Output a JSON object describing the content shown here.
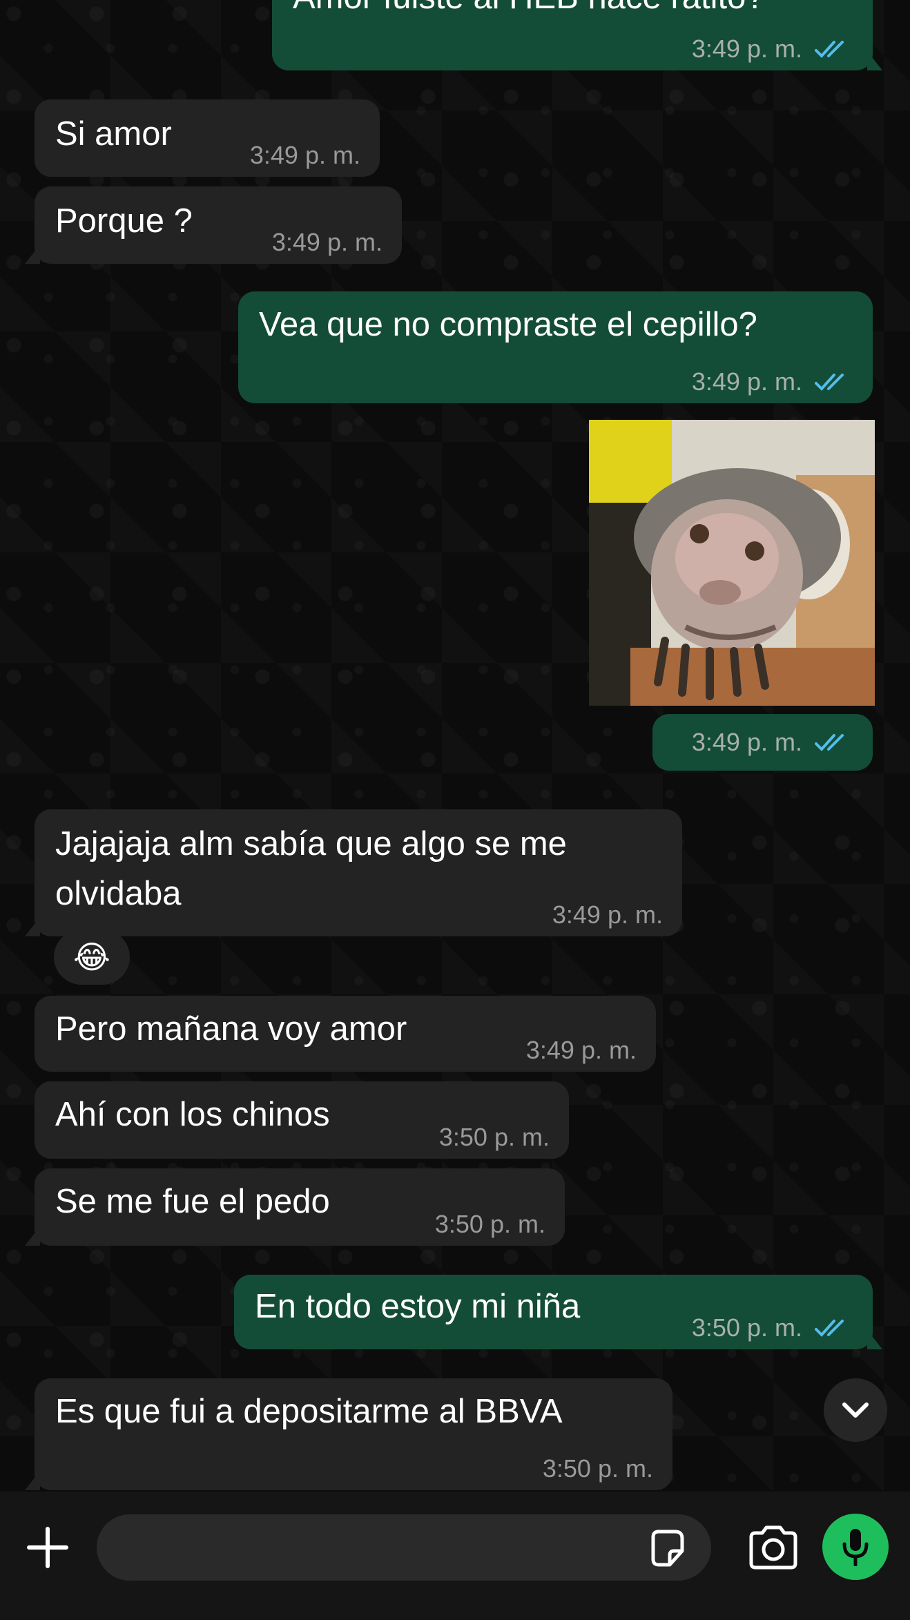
{
  "messages": [
    {
      "dir": "out",
      "text": "Amor fuiste al HEB hace ratito?",
      "time": "3:49",
      "ampm": "p. m."
    },
    {
      "dir": "in",
      "text": "Si amor",
      "time": "3:49",
      "ampm": "p. m."
    },
    {
      "dir": "in",
      "text": "Porque ?",
      "time": "3:49",
      "ampm": "p. m."
    },
    {
      "dir": "out",
      "text": "Vea que no compraste el cepillo?",
      "time": "3:49",
      "ampm": "p. m."
    },
    {
      "dir": "out",
      "type": "image",
      "image_desc": "monkey-photo",
      "time": "3:49",
      "ampm": "p. m."
    },
    {
      "dir": "in",
      "text": "Jajajaja alm sabía que algo se me olvidaba",
      "time": "3:49",
      "ampm": "p. m.",
      "reaction": "😂"
    },
    {
      "dir": "in",
      "text": "Pero mañana voy amor",
      "time": "3:49",
      "ampm": "p. m."
    },
    {
      "dir": "in",
      "text": "Ahí con los chinos",
      "time": "3:50",
      "ampm": "p. m."
    },
    {
      "dir": "in",
      "text": "Se me fue el pedo",
      "time": "3:50",
      "ampm": "p. m."
    },
    {
      "dir": "out",
      "text": "En todo estoy mi niña",
      "time": "3:50",
      "ampm": "p. m."
    },
    {
      "dir": "in",
      "text": "Es que fui a depositarme al BBVA",
      "time": "3:50",
      "ampm": "p. m."
    }
  ],
  "composer": {
    "placeholder": ""
  },
  "icons": {
    "plus": "plus-icon",
    "sticker": "sticker-icon",
    "camera": "camera-icon",
    "mic": "microphone-icon",
    "scroll": "chevron-down-icon",
    "read": "double-check-icon"
  },
  "colors": {
    "incoming_bubble": "#232323",
    "outgoing_bubble": "#144d37",
    "read_ticks": "#53bdeb",
    "mic_button": "#1fbe5c",
    "background": "#0b0b0b"
  }
}
